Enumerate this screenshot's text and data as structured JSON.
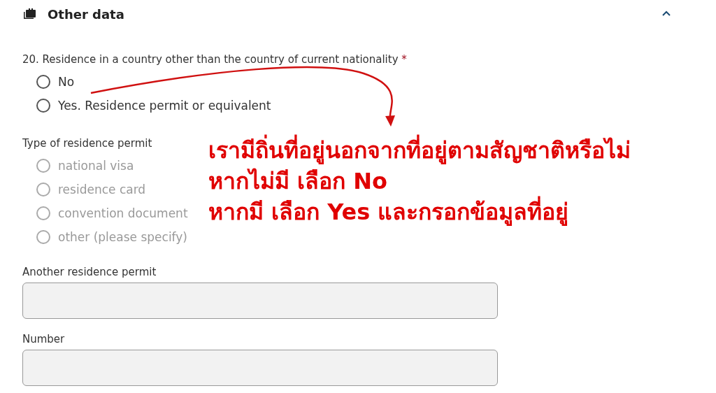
{
  "section": {
    "title": "Other data",
    "expanded": true
  },
  "question": {
    "label": "20. Residence in a country other than the country of current nationality",
    "required_mark": "*",
    "options": [
      {
        "label": "No",
        "selected": false,
        "disabled": false
      },
      {
        "label": "Yes. Residence permit or equivalent",
        "selected": false,
        "disabled": false
      }
    ]
  },
  "permit_type": {
    "label": "Type of residence permit",
    "options": [
      {
        "label": "national visa",
        "selected": false,
        "disabled": true
      },
      {
        "label": "residence card",
        "selected": false,
        "disabled": true
      },
      {
        "label": "convention document",
        "selected": false,
        "disabled": true
      },
      {
        "label": "other (please specify)",
        "selected": false,
        "disabled": true
      }
    ]
  },
  "fields": [
    {
      "label": "Another residence permit",
      "disabled": true
    },
    {
      "label": "Number",
      "disabled": true
    }
  ],
  "annotation": {
    "lines": [
      "เรามีถิ่นที่อยู่นอกจากที่อยู่ตามสัญชาติหรือไม่",
      "หากไม่มี เลือก No",
      "หากมี เลือก Yes และกรอกข้อมูลที่อยู่"
    ]
  }
}
